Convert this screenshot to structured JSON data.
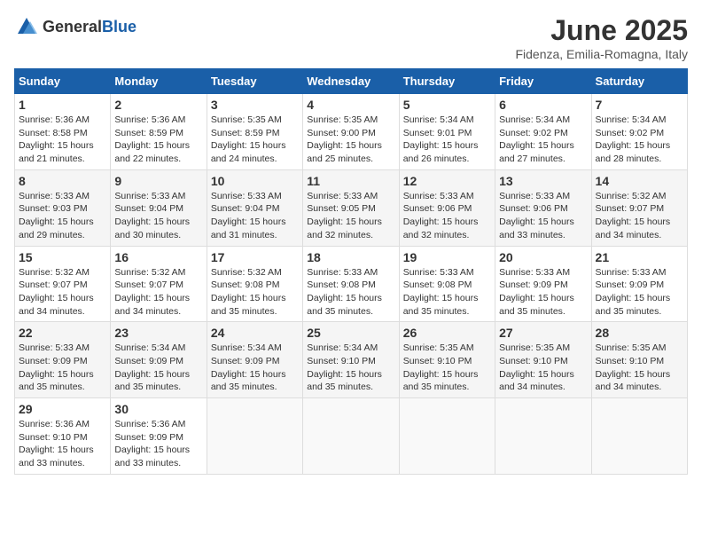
{
  "header": {
    "logo_general": "General",
    "logo_blue": "Blue",
    "title": "June 2025",
    "subtitle": "Fidenza, Emilia-Romagna, Italy"
  },
  "weekdays": [
    "Sunday",
    "Monday",
    "Tuesday",
    "Wednesday",
    "Thursday",
    "Friday",
    "Saturday"
  ],
  "weeks": [
    [
      {
        "day": 1,
        "sunrise": "5:36 AM",
        "sunset": "8:58 PM",
        "daylight": "15 hours and 21 minutes."
      },
      {
        "day": 2,
        "sunrise": "5:36 AM",
        "sunset": "8:59 PM",
        "daylight": "15 hours and 22 minutes."
      },
      {
        "day": 3,
        "sunrise": "5:35 AM",
        "sunset": "8:59 PM",
        "daylight": "15 hours and 24 minutes."
      },
      {
        "day": 4,
        "sunrise": "5:35 AM",
        "sunset": "9:00 PM",
        "daylight": "15 hours and 25 minutes."
      },
      {
        "day": 5,
        "sunrise": "5:34 AM",
        "sunset": "9:01 PM",
        "daylight": "15 hours and 26 minutes."
      },
      {
        "day": 6,
        "sunrise": "5:34 AM",
        "sunset": "9:02 PM",
        "daylight": "15 hours and 27 minutes."
      },
      {
        "day": 7,
        "sunrise": "5:34 AM",
        "sunset": "9:02 PM",
        "daylight": "15 hours and 28 minutes."
      }
    ],
    [
      {
        "day": 8,
        "sunrise": "5:33 AM",
        "sunset": "9:03 PM",
        "daylight": "15 hours and 29 minutes."
      },
      {
        "day": 9,
        "sunrise": "5:33 AM",
        "sunset": "9:04 PM",
        "daylight": "15 hours and 30 minutes."
      },
      {
        "day": 10,
        "sunrise": "5:33 AM",
        "sunset": "9:04 PM",
        "daylight": "15 hours and 31 minutes."
      },
      {
        "day": 11,
        "sunrise": "5:33 AM",
        "sunset": "9:05 PM",
        "daylight": "15 hours and 32 minutes."
      },
      {
        "day": 12,
        "sunrise": "5:33 AM",
        "sunset": "9:06 PM",
        "daylight": "15 hours and 32 minutes."
      },
      {
        "day": 13,
        "sunrise": "5:33 AM",
        "sunset": "9:06 PM",
        "daylight": "15 hours and 33 minutes."
      },
      {
        "day": 14,
        "sunrise": "5:32 AM",
        "sunset": "9:07 PM",
        "daylight": "15 hours and 34 minutes."
      }
    ],
    [
      {
        "day": 15,
        "sunrise": "5:32 AM",
        "sunset": "9:07 PM",
        "daylight": "15 hours and 34 minutes."
      },
      {
        "day": 16,
        "sunrise": "5:32 AM",
        "sunset": "9:07 PM",
        "daylight": "15 hours and 34 minutes."
      },
      {
        "day": 17,
        "sunrise": "5:32 AM",
        "sunset": "9:08 PM",
        "daylight": "15 hours and 35 minutes."
      },
      {
        "day": 18,
        "sunrise": "5:33 AM",
        "sunset": "9:08 PM",
        "daylight": "15 hours and 35 minutes."
      },
      {
        "day": 19,
        "sunrise": "5:33 AM",
        "sunset": "9:08 PM",
        "daylight": "15 hours and 35 minutes."
      },
      {
        "day": 20,
        "sunrise": "5:33 AM",
        "sunset": "9:09 PM",
        "daylight": "15 hours and 35 minutes."
      },
      {
        "day": 21,
        "sunrise": "5:33 AM",
        "sunset": "9:09 PM",
        "daylight": "15 hours and 35 minutes."
      }
    ],
    [
      {
        "day": 22,
        "sunrise": "5:33 AM",
        "sunset": "9:09 PM",
        "daylight": "15 hours and 35 minutes."
      },
      {
        "day": 23,
        "sunrise": "5:34 AM",
        "sunset": "9:09 PM",
        "daylight": "15 hours and 35 minutes."
      },
      {
        "day": 24,
        "sunrise": "5:34 AM",
        "sunset": "9:09 PM",
        "daylight": "15 hours and 35 minutes."
      },
      {
        "day": 25,
        "sunrise": "5:34 AM",
        "sunset": "9:10 PM",
        "daylight": "15 hours and 35 minutes."
      },
      {
        "day": 26,
        "sunrise": "5:35 AM",
        "sunset": "9:10 PM",
        "daylight": "15 hours and 35 minutes."
      },
      {
        "day": 27,
        "sunrise": "5:35 AM",
        "sunset": "9:10 PM",
        "daylight": "15 hours and 34 minutes."
      },
      {
        "day": 28,
        "sunrise": "5:35 AM",
        "sunset": "9:10 PM",
        "daylight": "15 hours and 34 minutes."
      }
    ],
    [
      {
        "day": 29,
        "sunrise": "5:36 AM",
        "sunset": "9:10 PM",
        "daylight": "15 hours and 33 minutes."
      },
      {
        "day": 30,
        "sunrise": "5:36 AM",
        "sunset": "9:09 PM",
        "daylight": "15 hours and 33 minutes."
      },
      null,
      null,
      null,
      null,
      null
    ]
  ]
}
